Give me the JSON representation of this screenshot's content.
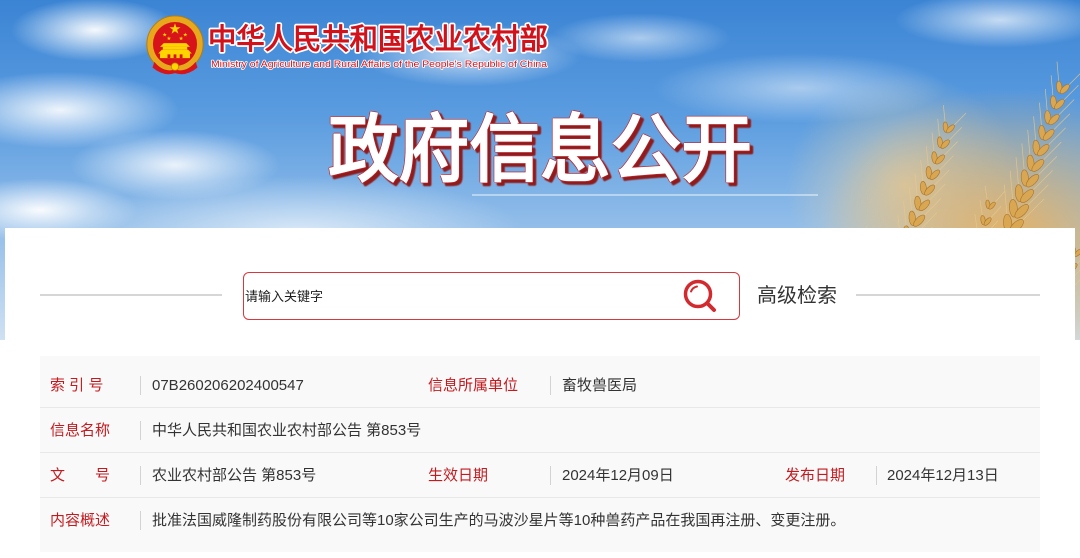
{
  "header": {
    "org_name_cn": "中华人民共和国农业农村部",
    "org_name_en": "Ministry of Agriculture and Rural Affairs of the People's Republic of China",
    "section_title": "政府信息公开"
  },
  "search": {
    "placeholder": "请输入关键字",
    "advanced_label": "高级检索"
  },
  "info": {
    "index_no": {
      "label": "索 引 号",
      "value": "07B260206202400547"
    },
    "department": {
      "label": "信息所属单位",
      "value": "畜牧兽医局"
    },
    "title": {
      "label": "信息名称",
      "value": "中华人民共和国农业农村部公告 第853号"
    },
    "doc_no": {
      "label": "文　　号",
      "value": "农业农村部公告 第853号"
    },
    "effective_date": {
      "label": "生效日期",
      "value": "2024年12月09日"
    },
    "publish_date": {
      "label": "发布日期",
      "value": "2024年12月13日"
    },
    "summary": {
      "label": "内容概述",
      "value": "批准法国威隆制药股份有限公司等10家公司生产的马波沙星片等10种兽药产品在我国再注册、变更注册。"
    }
  },
  "colors": {
    "brand_red": "#d1121b",
    "label_red": "#c41a1f",
    "search_border": "#d9363e",
    "text": "#333333",
    "sky_blue": "#3b84d4",
    "wheat_gold": "#d9a652"
  },
  "icons": {
    "logo": "national-emblem-icon",
    "search": "search-icon"
  }
}
